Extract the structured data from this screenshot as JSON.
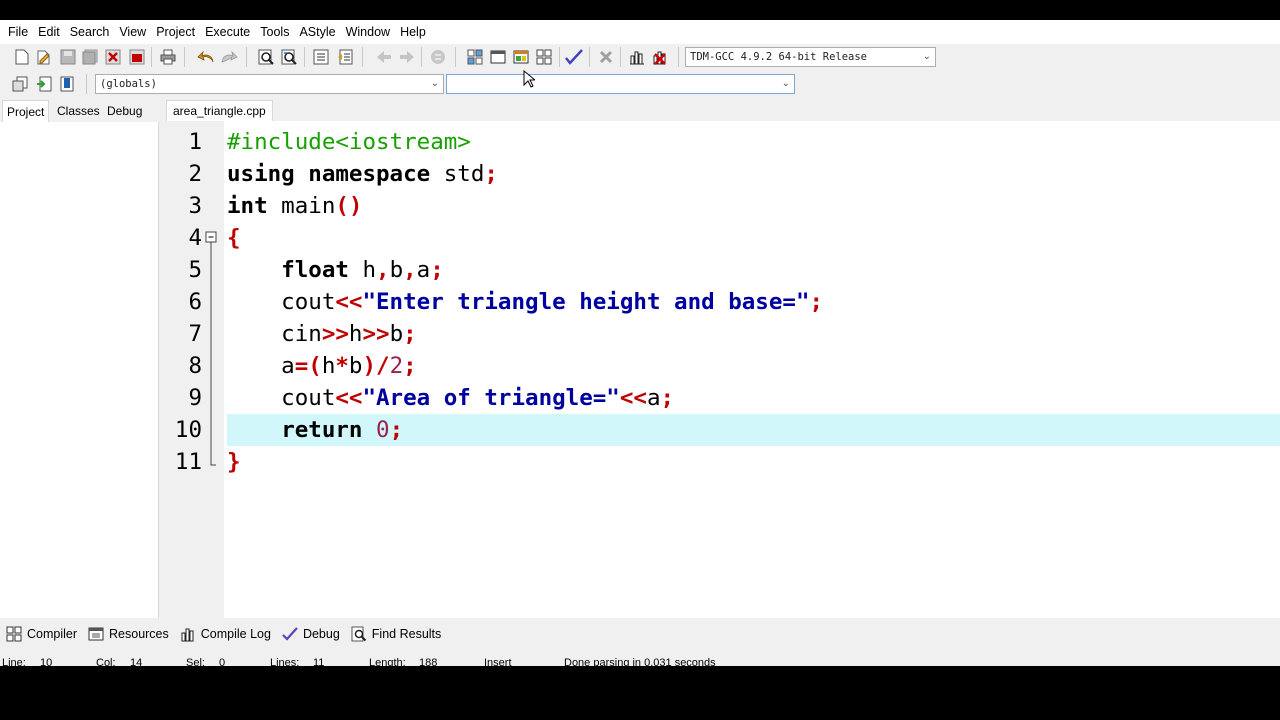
{
  "menu": [
    "File",
    "Edit",
    "Search",
    "View",
    "Project",
    "Execute",
    "Tools",
    "AStyle",
    "Window",
    "Help"
  ],
  "toolbar": {
    "compiler_select": "TDM-GCC 4.9.2 64-bit Release",
    "scope_select": "(globals)",
    "member_select": ""
  },
  "left_tabs": [
    "Project",
    "Classes",
    "Debug"
  ],
  "editor": {
    "file_tab": "area_triangle.cpp",
    "current_line": 10,
    "lines": [
      {
        "n": "1",
        "tokens": [
          [
            "pp",
            "#include<iostream>"
          ]
        ]
      },
      {
        "n": "2",
        "tokens": [
          [
            "kw",
            "using"
          ],
          [
            "plain",
            " "
          ],
          [
            "kw",
            "namespace"
          ],
          [
            "plain",
            " std"
          ],
          [
            "sym",
            ";"
          ]
        ]
      },
      {
        "n": "3",
        "tokens": [
          [
            "kw",
            "int"
          ],
          [
            "plain",
            " main"
          ],
          [
            "sym",
            "()"
          ]
        ]
      },
      {
        "n": "4",
        "tokens": [
          [
            "sym",
            "{"
          ]
        ]
      },
      {
        "n": "5",
        "tokens": [
          [
            "plain",
            "    "
          ],
          [
            "kw",
            "float"
          ],
          [
            "plain",
            " h"
          ],
          [
            "sym",
            ","
          ],
          [
            "plain",
            "b"
          ],
          [
            "sym",
            ","
          ],
          [
            "plain",
            "a"
          ],
          [
            "sym",
            ";"
          ]
        ]
      },
      {
        "n": "6",
        "tokens": [
          [
            "plain",
            "    cout"
          ],
          [
            "sym",
            "<<"
          ],
          [
            "str",
            "\"Enter triangle height and base=\""
          ],
          [
            "sym",
            ";"
          ]
        ]
      },
      {
        "n": "7",
        "tokens": [
          [
            "plain",
            "    cin"
          ],
          [
            "sym",
            ">>"
          ],
          [
            "plain",
            "h"
          ],
          [
            "sym",
            ">>"
          ],
          [
            "plain",
            "b"
          ],
          [
            "sym",
            ";"
          ]
        ]
      },
      {
        "n": "8",
        "tokens": [
          [
            "plain",
            "    a"
          ],
          [
            "sym",
            "=("
          ],
          [
            "plain",
            "h"
          ],
          [
            "sym",
            "*"
          ],
          [
            "plain",
            "b"
          ],
          [
            "sym",
            ")/"
          ],
          [
            "num",
            "2"
          ],
          [
            "sym",
            ";"
          ]
        ]
      },
      {
        "n": "9",
        "tokens": [
          [
            "plain",
            "    cout"
          ],
          [
            "sym",
            "<<"
          ],
          [
            "str",
            "\"Area of triangle=\""
          ],
          [
            "sym",
            "<<"
          ],
          [
            "plain",
            "a"
          ],
          [
            "sym",
            ";"
          ]
        ]
      },
      {
        "n": "10",
        "tokens": [
          [
            "plain",
            "    "
          ],
          [
            "kw",
            "return"
          ],
          [
            "plain",
            " "
          ],
          [
            "num",
            "0"
          ],
          [
            "sym",
            ";"
          ]
        ]
      },
      {
        "n": "11",
        "tokens": [
          [
            "sym",
            "}"
          ]
        ]
      }
    ]
  },
  "bottom_tabs": [
    {
      "label": "Compiler",
      "icon": "grid-icon"
    },
    {
      "label": "Resources",
      "icon": "resources-icon"
    },
    {
      "label": "Compile Log",
      "icon": "chart-icon"
    },
    {
      "label": "Debug",
      "icon": "check-icon"
    },
    {
      "label": "Find Results",
      "icon": "find-icon"
    }
  ],
  "status": {
    "line_label": "Line:",
    "line_value": "10",
    "col_label": "Col:",
    "col_value": "14",
    "sel_label": "Sel:",
    "sel_value": "0",
    "lines_label": "Lines:",
    "lines_value": "11",
    "length_label": "Length:",
    "length_value": "188",
    "mode": "Insert",
    "message": "Done parsing in 0.031 seconds"
  },
  "colors": {
    "keyword": "#000000",
    "preprocessor": "#17a000",
    "string": "#0000a0",
    "symbol": "#c00000",
    "number": "#9a2050",
    "current_line": "#d2f7fa"
  }
}
